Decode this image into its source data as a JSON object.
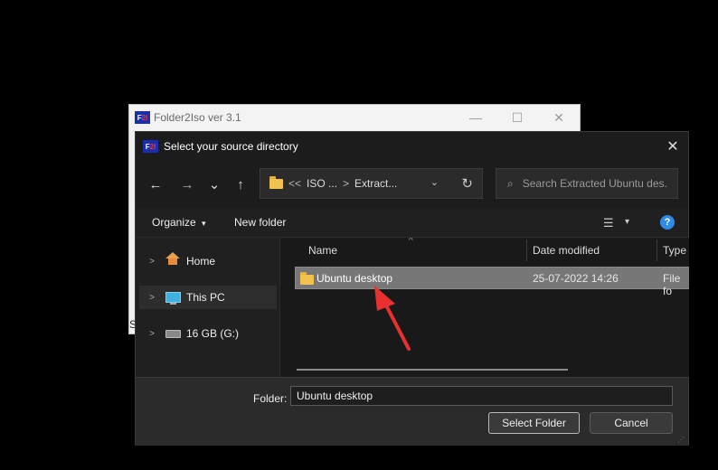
{
  "background_window": {
    "icon_text_a": "F",
    "icon_text_b": "2I",
    "title": "Folder2Iso ver 3.1",
    "minimize_glyph": "—",
    "maximize_glyph": "☐",
    "close_glyph": "✕",
    "edge_text": "S"
  },
  "dialog": {
    "icon_text_a": "F",
    "icon_text_b": "2I",
    "title": "Select your source directory",
    "close_glyph": "✕"
  },
  "nav": {
    "back": "←",
    "forward": "→",
    "recent": "⌄",
    "up": "↑"
  },
  "address": {
    "overflow": "<<",
    "crumbs": [
      "ISO ...",
      "Extract..."
    ],
    "separator": ">",
    "dropdown": "⌄",
    "refresh": "↻"
  },
  "search": {
    "icon": "⌕",
    "placeholder": "Search Extracted Ubuntu des..."
  },
  "toolbar": {
    "organize_label": "Organize",
    "organize_chevron": "▾",
    "new_folder_label": "New folder",
    "view_icon": "☰",
    "view_chevron": "▾",
    "help": "?"
  },
  "nav_pane": {
    "items": [
      {
        "label": "Home",
        "icon": "home-icon",
        "chevron": ">"
      },
      {
        "label": "This PC",
        "icon": "pc-icon",
        "chevron": ">",
        "selected": true
      },
      {
        "label": "16 GB (G:)",
        "icon": "drive-icon",
        "chevron": ">"
      }
    ]
  },
  "file_list": {
    "sort_glyph": "^",
    "columns": [
      "Name",
      "Date modified",
      "Type"
    ],
    "rows": [
      {
        "name": "Ubuntu desktop",
        "date": "25-07-2022 14:26",
        "type": "File fo"
      }
    ]
  },
  "footer": {
    "folder_label": "Folder:",
    "folder_value": "Ubuntu desktop",
    "select_button": "Select Folder",
    "cancel_button": "Cancel"
  },
  "colors": {
    "annotation_arrow": "#e8312e",
    "selected_row": "#777777",
    "folder_yellow": "#f2c14e"
  }
}
